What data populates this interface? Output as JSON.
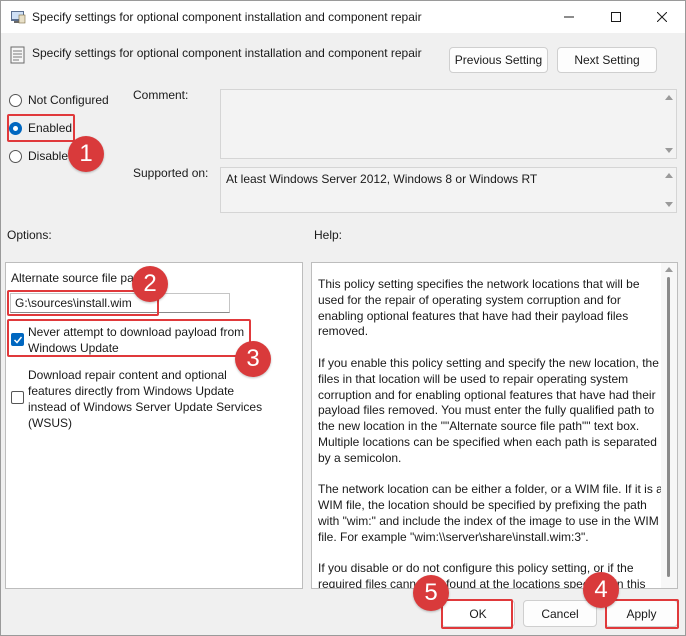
{
  "window": {
    "title": "Specify settings for optional component installation and component repair",
    "buttons": {
      "minimize": "minimize-icon",
      "maximize": "maximize-icon",
      "close": "close-icon"
    }
  },
  "header": {
    "title": "Specify settings for optional component installation and component repair",
    "previous_setting": "Previous Setting",
    "next_setting": "Next Setting"
  },
  "state": {
    "options": [
      {
        "label": "Not Configured",
        "selected": false
      },
      {
        "label": "Enabled",
        "selected": true
      },
      {
        "label": "Disabled",
        "selected": false
      }
    ]
  },
  "comment": {
    "label": "Comment:",
    "value": ""
  },
  "supported": {
    "label": "Supported on:",
    "value": "At least Windows Server 2012, Windows 8 or Windows RT"
  },
  "options_pane": {
    "label": "Options:",
    "alt_source_label": "Alternate source file path",
    "alt_source_value": "G:\\sources\\install.wim",
    "never_download_label": "Never attempt to download payload from Windows Update",
    "never_download_checked": true,
    "direct_wu_label": "Download repair content and optional features directly from Windows Update instead of Windows Server Update Services (WSUS)",
    "direct_wu_checked": false
  },
  "help_pane": {
    "label": "Help:",
    "paragraphs": [
      "This policy setting specifies the network locations that will be used for the repair of operating system corruption and for enabling optional features that have had their payload files removed.",
      "If you enable this policy setting and specify the new location, the files in that location will be used to repair operating system corruption and for enabling optional features that have had their payload files removed. You must enter the fully qualified path to the new location in the \"\"Alternate source file path\"\" text box. Multiple locations can be specified when each path is separated by a semicolon.",
      "The network location can be either a folder, or a WIM file. If it is a WIM file, the location should be specified by prefixing the path with \"wim:\" and include the index of the image to use in the WIM file. For example \"wim:\\\\server\\share\\install.wim:3\".",
      "If you disable or do not configure this policy setting, or if the required files cannot be found at the locations specified in this policy setting, the files will be downloaded from Windows Update, if that is allowed by the policy settings for the computer."
    ]
  },
  "footer": {
    "ok": "OK",
    "cancel": "Cancel",
    "apply": "Apply"
  },
  "annotations": {
    "color": "#d93a3b",
    "badges": [
      "1",
      "2",
      "3",
      "4",
      "5"
    ]
  }
}
